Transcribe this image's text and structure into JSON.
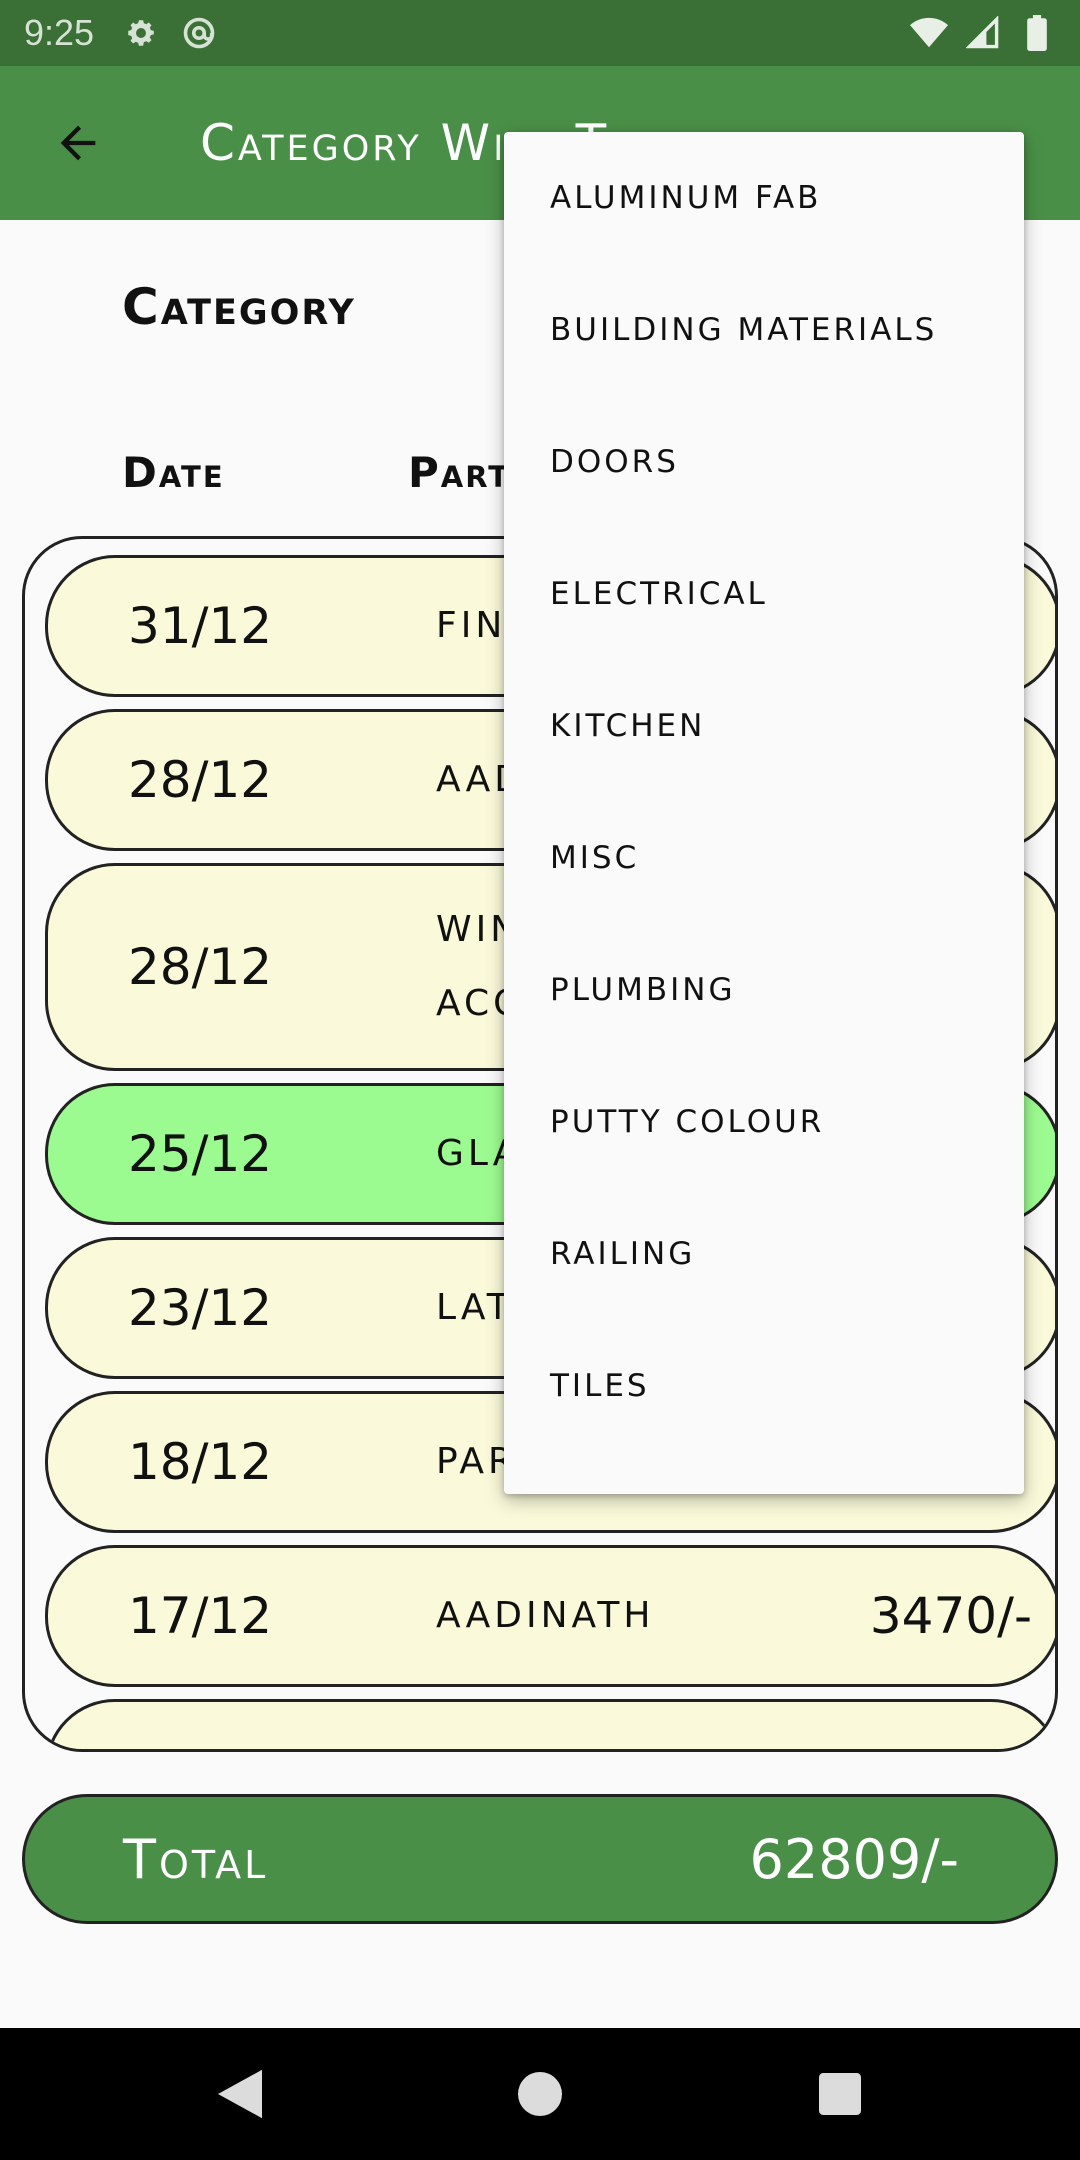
{
  "status_bar": {
    "time": "9:25",
    "icons_left": [
      "gear-icon",
      "at-sign-icon"
    ],
    "icons_right": [
      "wifi-icon",
      "signal-icon",
      "battery-icon"
    ]
  },
  "app_bar": {
    "title": "Category Wise T",
    "back_icon": "arrow-left-icon"
  },
  "category_label": "Category",
  "table_header": {
    "date": "Date",
    "party": "Part"
  },
  "rows": [
    {
      "date": "31/12",
      "party": "Final",
      "amount": "",
      "highlight": false
    },
    {
      "date": "28/12",
      "party": "Aadi",
      "amount": "",
      "highlight": false
    },
    {
      "date": "28/12",
      "party": "Wind\nAcce",
      "amount": "",
      "highlight": false
    },
    {
      "date": "25/12",
      "party": "Glas",
      "amount": "",
      "highlight": true
    },
    {
      "date": "23/12",
      "party": "Latc",
      "amount": "",
      "highlight": false
    },
    {
      "date": "18/12",
      "party": "Pars",
      "amount": "",
      "highlight": false
    },
    {
      "date": "17/12",
      "party": "Aadinath",
      "amount": "3470/-",
      "highlight": false
    }
  ],
  "total": {
    "label": "Total",
    "value": "62809/-"
  },
  "dropdown": {
    "items": [
      "Aluminum Fab",
      "Building Materials",
      "Doors",
      "Electrical",
      "Kitchen",
      "Misc",
      "Plumbing",
      "Putty Colour",
      "Railing",
      "Tiles"
    ]
  },
  "colors": {
    "app_bar": "#4a8f48",
    "status_bar": "#3a6f36",
    "row_bg": "#faf9d9",
    "row_highlight": "#9cfb90"
  },
  "nav_bar": {
    "icons": [
      "back-triangle-icon",
      "home-circle-icon",
      "recents-square-icon"
    ]
  }
}
